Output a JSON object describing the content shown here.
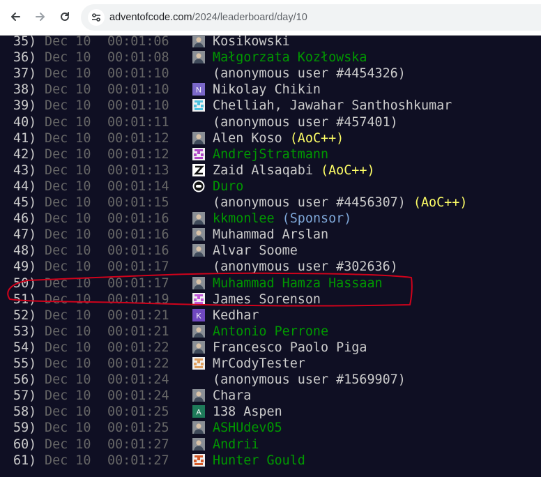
{
  "browser": {
    "url_host": "adventofcode.com",
    "url_path": "/2024/leaderboard/day/10"
  },
  "rows": [
    {
      "rank": "35)",
      "date": "Dec 10",
      "time": "00:01:06",
      "name": "Kosikowski",
      "link": false,
      "tag": "",
      "avatar": "photo-icon"
    },
    {
      "rank": "36)",
      "date": "Dec 10",
      "time": "00:01:08",
      "name": "Małgorzata Kozłowska",
      "link": true,
      "tag": "",
      "avatar": "photo-icon"
    },
    {
      "rank": "37)",
      "date": "Dec 10",
      "time": "00:01:10",
      "name": "(anonymous user #4454326)",
      "link": false,
      "tag": "",
      "avatar": ""
    },
    {
      "rank": "38)",
      "date": "Dec 10",
      "time": "00:01:10",
      "name": "Nikolay Chikin",
      "link": false,
      "tag": "",
      "avatar": "letter-avatar",
      "letter": "N",
      "color": "#7b68c9"
    },
    {
      "rank": "39)",
      "date": "Dec 10",
      "time": "00:01:10",
      "name": "Chelliah, Jawahar Santhoshkumar",
      "link": false,
      "tag": "",
      "avatar": "identicon",
      "color": "#4ec2e0"
    },
    {
      "rank": "40)",
      "date": "Dec 10",
      "time": "00:01:11",
      "name": "(anonymous user #457401)",
      "link": false,
      "tag": "",
      "avatar": ""
    },
    {
      "rank": "41)",
      "date": "Dec 10",
      "time": "00:01:12",
      "name": "Alen Koso",
      "link": false,
      "tag": "(AoC++)",
      "avatar": "photo-icon"
    },
    {
      "rank": "42)",
      "date": "Dec 10",
      "time": "00:01:12",
      "name": "AndrejStratmann",
      "link": true,
      "tag": "",
      "avatar": "identicon",
      "color": "#b048c6"
    },
    {
      "rank": "43)",
      "date": "Dec 10",
      "time": "00:01:13",
      "name": "Zaid Alsaqabi",
      "link": false,
      "tag": "(AoC++)",
      "avatar": "z-logo"
    },
    {
      "rank": "44)",
      "date": "Dec 10",
      "time": "00:01:14",
      "name": "Duro",
      "link": true,
      "tag": "",
      "avatar": "dd-logo"
    },
    {
      "rank": "45)",
      "date": "Dec 10",
      "time": "00:01:15",
      "name": "(anonymous user #4456307)",
      "link": false,
      "tag": "(AoC++)",
      "avatar": ""
    },
    {
      "rank": "46)",
      "date": "Dec 10",
      "time": "00:01:16",
      "name": "kkmonlee",
      "link": true,
      "tag": "(Sponsor)",
      "tag_type": "sponsor",
      "avatar": "photo-icon"
    },
    {
      "rank": "47)",
      "date": "Dec 10",
      "time": "00:01:16",
      "name": "Muhammad Arslan",
      "link": false,
      "tag": "",
      "avatar": "photo-icon"
    },
    {
      "rank": "48)",
      "date": "Dec 10",
      "time": "00:01:16",
      "name": "Alvar Soome",
      "link": false,
      "tag": "",
      "avatar": "photo-icon"
    },
    {
      "rank": "49)",
      "date": "Dec 10",
      "time": "00:01:17",
      "name": "(anonymous user #302636)",
      "link": false,
      "tag": "",
      "avatar": ""
    },
    {
      "rank": "50)",
      "date": "Dec 10",
      "time": "00:01:17",
      "name": "Muhammad Hamza Hassaan",
      "link": true,
      "tag": "",
      "avatar": "photo-icon"
    },
    {
      "rank": "51)",
      "date": "Dec 10",
      "time": "00:01:19",
      "name": "James Sorenson",
      "link": false,
      "tag": "",
      "avatar": "identicon",
      "color": "#c05ad8"
    },
    {
      "rank": "52)",
      "date": "Dec 10",
      "time": "00:01:21",
      "name": "Kedhar",
      "link": false,
      "tag": "",
      "avatar": "letter-avatar",
      "letter": "K",
      "color": "#7048c0"
    },
    {
      "rank": "53)",
      "date": "Dec 10",
      "time": "00:01:21",
      "name": "Antonio Perrone",
      "link": true,
      "tag": "",
      "avatar": "photo-icon"
    },
    {
      "rank": "54)",
      "date": "Dec 10",
      "time": "00:01:22",
      "name": "Francesco Paolo Piga",
      "link": false,
      "tag": "",
      "avatar": "photo-icon"
    },
    {
      "rank": "55)",
      "date": "Dec 10",
      "time": "00:01:22",
      "name": "MrCodyTester",
      "link": false,
      "tag": "",
      "avatar": "identicon",
      "color": "#e0a060"
    },
    {
      "rank": "56)",
      "date": "Dec 10",
      "time": "00:01:24",
      "name": "(anonymous user #1569907)",
      "link": false,
      "tag": "",
      "avatar": ""
    },
    {
      "rank": "57)",
      "date": "Dec 10",
      "time": "00:01:24",
      "name": "Chara",
      "link": false,
      "tag": "",
      "avatar": "photo-icon"
    },
    {
      "rank": "58)",
      "date": "Dec 10",
      "time": "00:01:25",
      "name": "138 Aspen",
      "link": false,
      "tag": "",
      "avatar": "letter-avatar",
      "letter": "A",
      "color": "#1e7b5a"
    },
    {
      "rank": "59)",
      "date": "Dec 10",
      "time": "00:01:25",
      "name": "ASHUdev05",
      "link": true,
      "tag": "",
      "avatar": "photo-icon"
    },
    {
      "rank": "60)",
      "date": "Dec 10",
      "time": "00:01:27",
      "name": "Andrii",
      "link": true,
      "tag": "",
      "avatar": "photo-icon"
    },
    {
      "rank": "61)",
      "date": "Dec 10",
      "time": "00:01:27",
      "name": "Hunter Gould",
      "link": true,
      "tag": "",
      "avatar": "identicon",
      "color": "#d45a2a"
    }
  ],
  "colors": {
    "background": "#0f0f23",
    "text": "#cccccc",
    "muted": "#666666",
    "link": "#009900",
    "aoc_plus": "#ffff66",
    "annotation": "#d0021b"
  }
}
